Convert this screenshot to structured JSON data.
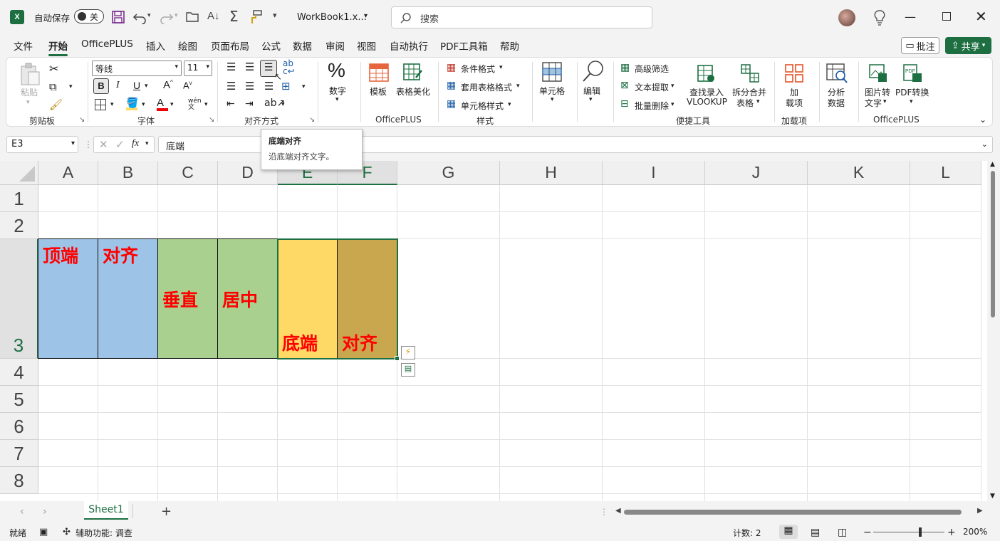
{
  "titlebar": {
    "autosave_label": "自动保存",
    "autosave_state": "关",
    "workbook_name": "WorkBook1.x...",
    "search_placeholder": "搜索"
  },
  "menu": {
    "tabs": [
      "文件",
      "开始",
      "OfficePLUS",
      "插入",
      "绘图",
      "页面布局",
      "公式",
      "数据",
      "审阅",
      "视图",
      "自动执行",
      "PDF工具箱",
      "帮助"
    ],
    "active": "开始",
    "comment_label": "批注",
    "share_label": "共享"
  },
  "ribbon": {
    "clipboard": {
      "paste": "粘贴",
      "label": "剪贴板"
    },
    "font": {
      "name": "等线",
      "size": "11",
      "label": "字体"
    },
    "alignment": {
      "label": "对齐方式"
    },
    "number": {
      "label": "数字"
    },
    "officeplus1": {
      "template": "模板",
      "beautify": "表格美化",
      "label": "OfficePLUS"
    },
    "styles": {
      "conditional": "条件格式",
      "table_format": "套用表格格式",
      "cell_style": "单元格样式",
      "label": "样式"
    },
    "cells": {
      "label": "单元格"
    },
    "editing": {
      "label": "编辑"
    },
    "quick_tools": {
      "advanced_filter": "高级筛选",
      "text_extract": "文本提取",
      "batch_delete": "批量删除",
      "lookup_line1": "查找录入",
      "lookup_line2": "VLOOKUP",
      "split_line1": "拆分合并",
      "split_line2": "表格",
      "label": "便捷工具"
    },
    "addins": {
      "line1": "加",
      "line2": "载项",
      "label": "加载项"
    },
    "analyze": {
      "line1": "分析",
      "line2": "数据"
    },
    "officeplus2": {
      "img_line1": "图片转",
      "img_line2": "文字",
      "pdf_convert": "PDF转换",
      "label": "OfficePLUS"
    }
  },
  "tooltip": {
    "title": "底端对齐",
    "desc": "沿底端对齐文字。"
  },
  "formula": {
    "namebox": "E3",
    "content": "底端"
  },
  "sheet": {
    "columns": [
      "A",
      "B",
      "C",
      "D",
      "E",
      "F",
      "G",
      "H",
      "I",
      "J",
      "K",
      "L"
    ],
    "rows": [
      "1",
      "2",
      "3",
      "4",
      "5",
      "6",
      "7",
      "8"
    ],
    "cells": [
      {
        "ref": "A3",
        "text": "顶端",
        "color": "#9dc3e6"
      },
      {
        "ref": "B3",
        "text": "对齐",
        "color": "#9dc3e6"
      },
      {
        "ref": "C3",
        "text": "垂直",
        "color": "#a9d08e"
      },
      {
        "ref": "D3",
        "text": "居中",
        "color": "#a9d08e"
      },
      {
        "ref": "E3",
        "text": "底端",
        "color": "#ffd966"
      },
      {
        "ref": "F3",
        "text": "对齐",
        "color": "#c9a74e"
      }
    ]
  },
  "tabs": {
    "sheet1": "Sheet1",
    "add": "+"
  },
  "status": {
    "ready": "就绪",
    "accessibility": "辅助功能: 调查",
    "count": "计数: 2",
    "zoom": "200%"
  },
  "colors": {
    "accent": "#1d6f42",
    "text_red": "#ff0000"
  }
}
